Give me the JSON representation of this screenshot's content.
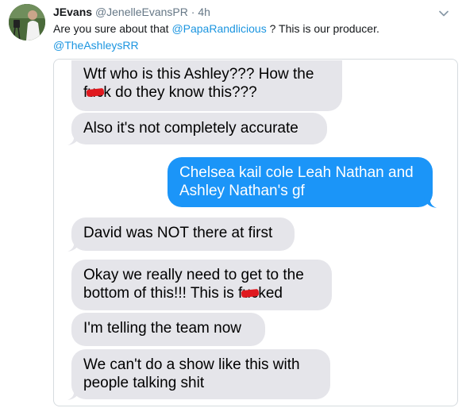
{
  "tweet": {
    "display_name": "JEvans",
    "handle": "@JenelleEvansPR",
    "separator": "·",
    "time": "4h",
    "text_before": "Are you sure about that ",
    "mention_1": "@PapaRandlicious",
    "text_after": " ? This is our producer.",
    "mention_2": "@TheAshleysRR"
  },
  "icons": {
    "avatar": "avatar-photo",
    "menu": "chevron-down-icon"
  },
  "colors": {
    "received_bubble": "#e5e5ea",
    "sent_bubble": "#1b95f8",
    "mention": "#1b95e0",
    "redaction": "#e0191f"
  },
  "messages": {
    "m1_line1": "Wtf who is this Ashley??? How the",
    "m1_l2_pre": "f",
    "m1_l2_redacted": "uc",
    "m1_l2_post": "k do they know this???",
    "m2": "Also it's not completely accurate",
    "m3_line1": "Chelsea kail cole Leah Nathan and",
    "m3_line2": "Ashley Nathan's gf",
    "m4": "David was NOT there at first",
    "m5_line1": "Okay we really need to get to the",
    "m5_l2_pre": "bottom of this!!! This is f",
    "m5_l2_redacted": "uc",
    "m5_l2_post": "ked",
    "m6": "I'm telling the team now",
    "m7_line1": "We can't do a show like this with",
    "m7_line2": "people talking shit"
  }
}
